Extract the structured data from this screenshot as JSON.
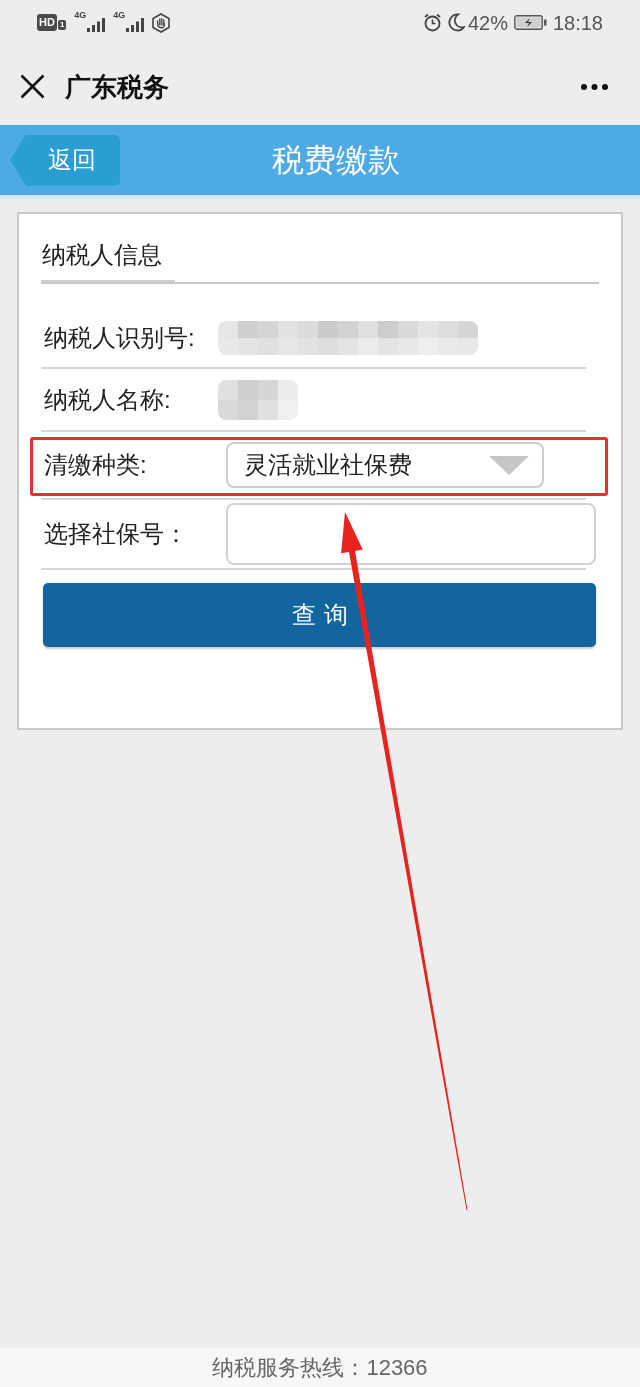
{
  "status_bar": {
    "network": [
      {
        "kind": "hd",
        "label": "HD",
        "sim": "1"
      },
      {
        "kind": "signal",
        "label": "4G"
      },
      {
        "kind": "signal",
        "label": "4G"
      }
    ],
    "battery": "42%",
    "time": "18:18"
  },
  "app_bar": {
    "title": "广东税务"
  },
  "header": {
    "back": "返回",
    "title": "税费缴款"
  },
  "form": {
    "section_title": "纳税人信息",
    "rows": [
      {
        "kind": "text",
        "label": "纳税人识别号:",
        "redacted": true,
        "highlighted": false
      },
      {
        "kind": "text",
        "label": "纳税人名称:",
        "redacted": true,
        "highlighted": false
      },
      {
        "kind": "select",
        "label": "清缴种类:",
        "value": "灵活就业社保费",
        "highlighted": true
      },
      {
        "kind": "input",
        "label": "选择社保号：",
        "highlighted": false
      }
    ],
    "submit": "查询"
  },
  "footer": {
    "hotline": "纳税服务热线：12366"
  },
  "annotations": [
    {
      "kind": "arrow"
    }
  ]
}
